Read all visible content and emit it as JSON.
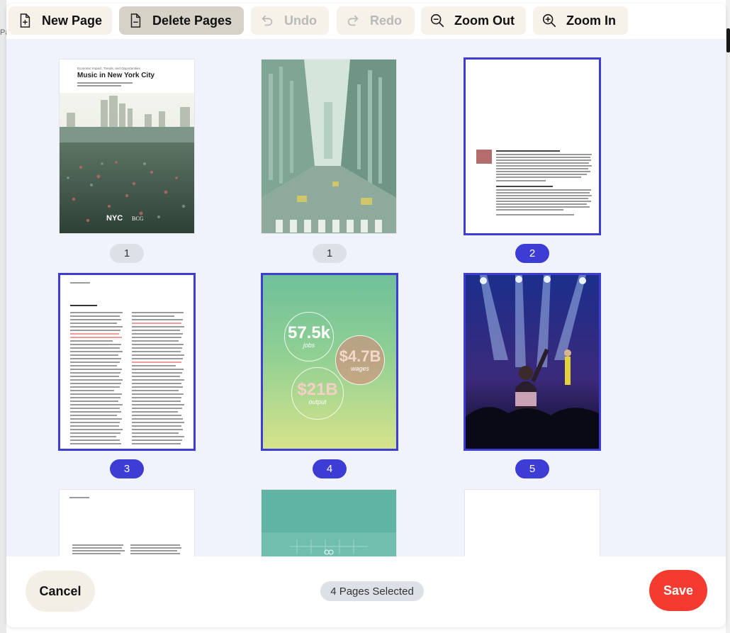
{
  "toolbar": {
    "new_page": "New Page",
    "delete_pages": "Delete Pages",
    "undo": "Undo",
    "redo": "Redo",
    "zoom_out": "Zoom Out",
    "zoom_in": "Zoom In"
  },
  "cover": {
    "subtitle": "Economic Impact, Trends, and Opportunities",
    "title": "Music in New York City"
  },
  "pages": [
    {
      "label": "1",
      "selected": false
    },
    {
      "label": "1",
      "selected": false
    },
    {
      "label": "2",
      "selected": true
    },
    {
      "label": "3",
      "selected": true
    },
    {
      "label": "4",
      "selected": true
    },
    {
      "label": "5",
      "selected": true
    }
  ],
  "stats": {
    "jobs_value": "57.5k",
    "jobs_label": "jobs",
    "wages_value": "$4.7B",
    "wages_label": "wages",
    "output_value": "$21B",
    "output_label": "output"
  },
  "footer": {
    "cancel": "Cancel",
    "selected_count": "4 Pages Selected",
    "save": "Save"
  },
  "colors": {
    "selection": "#3d3dd6",
    "save": "#f53b30",
    "toolbar_button": "#f6f2e9",
    "canvas": "#f0f3fb"
  }
}
